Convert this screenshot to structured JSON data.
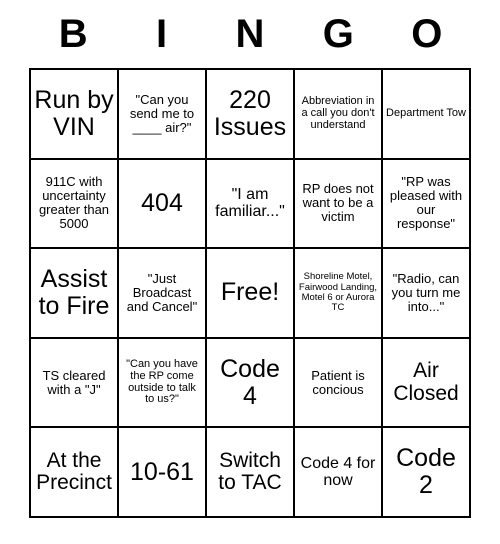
{
  "card": {
    "title": "BINGO",
    "header_letters": [
      "B",
      "I",
      "N",
      "G",
      "O"
    ],
    "grid_size": 5,
    "colors": {
      "border": "#000000",
      "background": "#ffffff",
      "text": "#000000"
    },
    "cells": [
      {
        "text": "Run by VIN",
        "size": "xl"
      },
      {
        "text": "\"Can you send me to ____ air?\"",
        "size": "sm"
      },
      {
        "text": "220 Issues",
        "size": "xl"
      },
      {
        "text": "Abbreviation in a call you don't understand",
        "size": "xs"
      },
      {
        "text": "Department Tow",
        "size": "xs"
      },
      {
        "text": "911C with uncertainty greater than 5000",
        "size": "sm"
      },
      {
        "text": "404",
        "size": "xl"
      },
      {
        "text": "\"I am familiar...\"",
        "size": "md"
      },
      {
        "text": "RP does not want to be a victim",
        "size": "sm"
      },
      {
        "text": "\"RP was pleased with our response\"",
        "size": "sm"
      },
      {
        "text": "Assist to Fire",
        "size": "xl"
      },
      {
        "text": "\"Just Broadcast and Cancel\"",
        "size": "sm"
      },
      {
        "text": "Free!",
        "size": "xl"
      },
      {
        "text": "Shoreline Motel, Fairwood Landing, Motel 6 or Aurora TC",
        "size": "xxs"
      },
      {
        "text": "\"Radio, can you turn me into...\"",
        "size": "sm"
      },
      {
        "text": "TS cleared with a \"J\"",
        "size": "sm"
      },
      {
        "text": "\"Can you have the RP come outside to talk to us?\"",
        "size": "xs"
      },
      {
        "text": "Code 4",
        "size": "xl"
      },
      {
        "text": "Patient is concious",
        "size": "sm"
      },
      {
        "text": "Air Closed",
        "size": "lg"
      },
      {
        "text": "At the Precinct",
        "size": "lg"
      },
      {
        "text": "10-61",
        "size": "xl"
      },
      {
        "text": "Switch to TAC",
        "size": "lg"
      },
      {
        "text": "Code 4 for now",
        "size": "md"
      },
      {
        "text": "Code 2",
        "size": "xl"
      }
    ]
  }
}
